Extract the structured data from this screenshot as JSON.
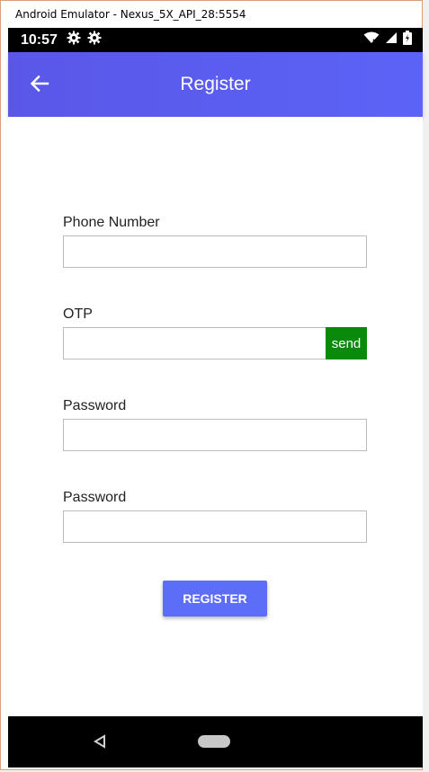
{
  "window": {
    "title": "Android Emulator - Nexus_5X_API_28:5554"
  },
  "status_bar": {
    "time": "10:57",
    "icons": [
      "gear-icon",
      "gear-icon",
      "wifi-icon",
      "signal-icon",
      "battery-charging-icon"
    ]
  },
  "app_bar": {
    "title": "Register",
    "back_icon": "arrow-left-icon",
    "color": "#5b5ef0"
  },
  "form": {
    "phone_label": "Phone Number",
    "phone_value": "",
    "otp_label": "OTP",
    "otp_value": "",
    "send_label": "send",
    "send_color": "#0a8a0a",
    "password_label": "Password",
    "password_value": "",
    "confirm_label": "Password",
    "confirm_value": "",
    "register_label": "REGISTER",
    "register_color": "#5c6df7"
  },
  "nav_bar": {
    "icons": [
      "nav-back-icon",
      "nav-home-icon"
    ]
  }
}
